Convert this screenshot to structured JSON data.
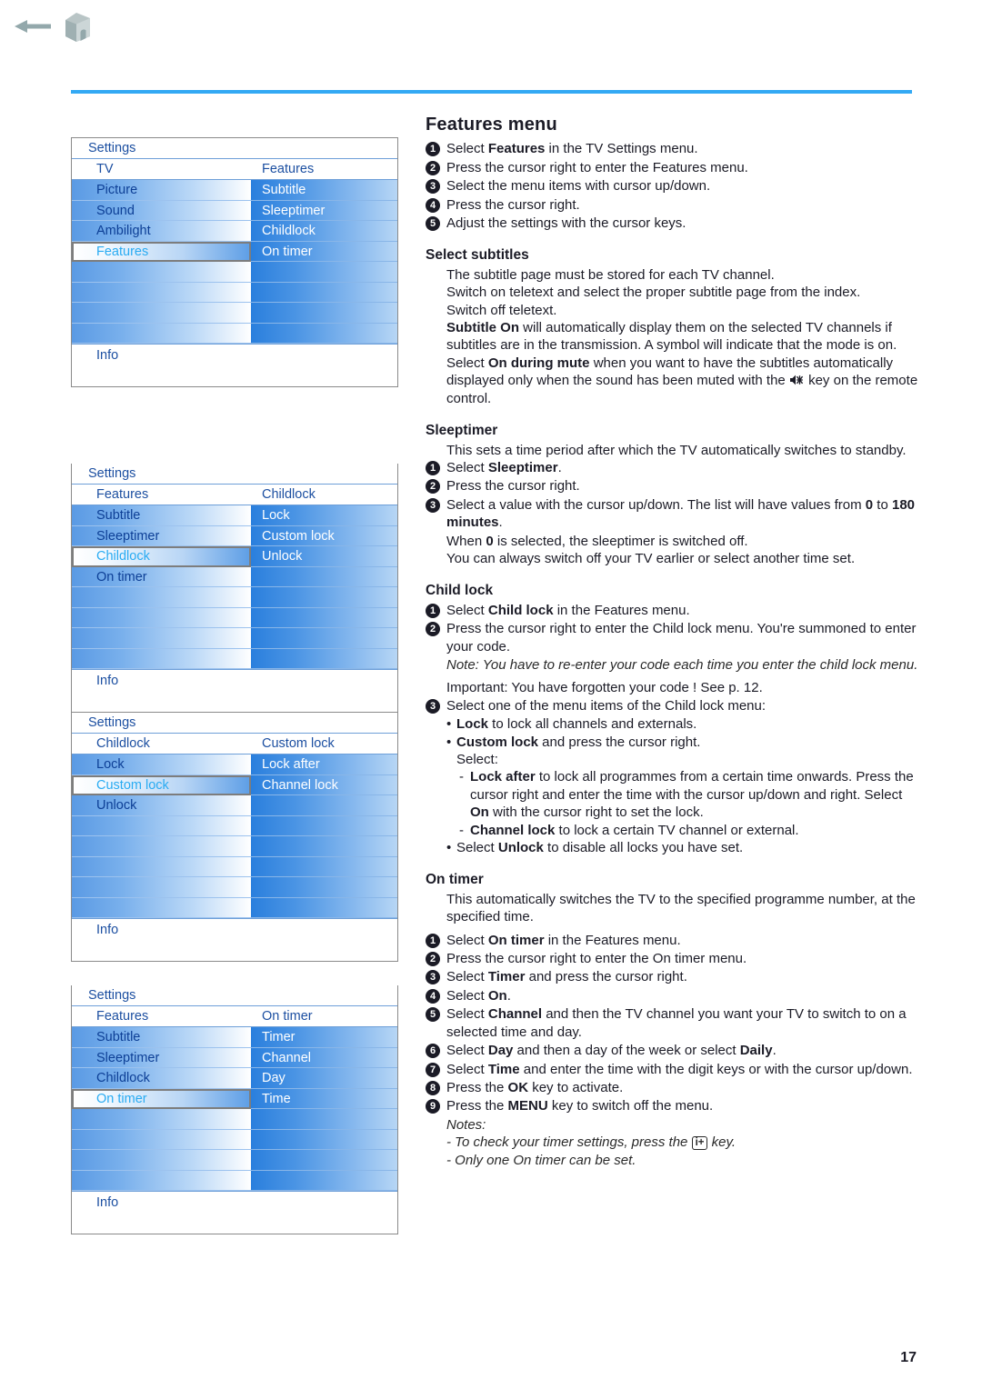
{
  "header": {
    "back_icon": "back-arrow-icon",
    "home_icon": "home-icon",
    "divider_color": "#33a9f4"
  },
  "page_number": "17",
  "menus": [
    {
      "title": "Settings",
      "head_left": "TV",
      "head_right": "Features",
      "left_items": [
        "Picture",
        "Sound",
        "Ambilight",
        "Features",
        "",
        "",
        "",
        ""
      ],
      "left_selected_index": 3,
      "right_items": [
        "Subtitle",
        "Sleeptimer",
        "Childlock",
        "On timer",
        "",
        "",
        "",
        ""
      ],
      "info": "Info"
    },
    {
      "title": "Settings",
      "head_left": "Features",
      "head_right": "Childlock",
      "left_items": [
        "Subtitle",
        "Sleeptimer",
        "Childlock",
        "On timer",
        "",
        "",
        "",
        ""
      ],
      "left_selected_index": 2,
      "right_items": [
        "Lock",
        "Custom lock",
        "Unlock",
        "",
        "",
        "",
        "",
        ""
      ],
      "info": "Info"
    },
    {
      "title": "Settings",
      "head_left": "Childlock",
      "head_right": "Custom lock",
      "left_items": [
        "Lock",
        "Custom lock",
        "Unlock",
        "",
        "",
        "",
        "",
        ""
      ],
      "left_selected_index": 1,
      "right_items": [
        "Lock after",
        "Channel lock",
        "",
        "",
        "",
        "",
        "",
        ""
      ],
      "info": "Info"
    },
    {
      "title": "Settings",
      "head_left": "Features",
      "head_right": "On timer",
      "left_items": [
        "Subtitle",
        "Sleeptimer",
        "Childlock",
        "On timer",
        "",
        "",
        "",
        ""
      ],
      "left_selected_index": 3,
      "right_items": [
        "Timer",
        "Channel",
        "Day",
        "Time",
        "",
        "",
        "",
        ""
      ],
      "info": "Info"
    }
  ],
  "content": {
    "title": "Features menu",
    "intro_steps": [
      "Select Features in the TV Settings menu.",
      "Press the cursor right to enter the Features menu.",
      "Select the menu items with cursor up/down.",
      "Press the cursor right.",
      "Adjust the settings with the cursor keys."
    ],
    "select_subtitles": {
      "heading": "Select subtitles",
      "lines": [
        "The subtitle page must be stored for each TV channel.",
        "Switch on teletext and select the proper subtitle page from the index.",
        "Switch off teletext.",
        "Subtitle On will automatically display them on the selected TV channels if subtitles are in the transmission. A symbol will indicate that the mode is on.",
        "Select On during mute when you want to have the subtitles automatically displayed only when the sound has been muted with the  key on the remote control."
      ]
    },
    "sleeptimer": {
      "heading": "Sleeptimer",
      "intro": "This sets a time period after which the TV automatically switches to standby.",
      "steps": [
        "Select Sleeptimer.",
        "Press the cursor right.",
        "Select a value with the cursor up/down. The list will have values from 0 to 180 minutes."
      ],
      "extra": [
        "When 0 is selected, the sleeptimer is switched off.",
        "You can always switch off your TV earlier or select another time set."
      ]
    },
    "child_lock": {
      "heading": "Child lock",
      "step1": "Select Child lock in the Features menu.",
      "step2": "Press the cursor right to enter the Child lock menu. You're summoned to enter your code.",
      "note": "Note: You have to re-enter your code each time you enter the child lock menu.",
      "important": "Important: You have forgotten your code ! See p. 12.",
      "step3": "Select one of the menu items of the Child lock menu:",
      "bullet_lock": "Lock to lock all channels and externals.",
      "bullet_custom": "Custom lock and press the cursor right.",
      "select_label": "Select:",
      "dash_lock_after": "Lock after to lock all programmes from a certain time onwards. Press the cursor right and enter the time with the cursor up/down and right. Select On with the cursor right to set the lock.",
      "dash_channel_lock": "Channel lock to lock a certain TV channel or external.",
      "bullet_unlock": "Select Unlock to disable all locks you have set."
    },
    "on_timer": {
      "heading": "On timer",
      "intro": "This automatically switches the TV to the specified programme number, at the specified time.",
      "steps": [
        "Select On timer in the Features menu.",
        "Press the cursor right to enter the On timer menu.",
        "Select Timer and press the cursor right.",
        "Select On.",
        "Select Channel and then the TV channel you want your TV to switch to on a selected time and day.",
        "Select Day and then a day of the week or select Daily.",
        "Select Time and enter the time with the digit keys or with the cursor up/down.",
        "Press the OK key to activate.",
        "Press the MENU key to switch off the menu."
      ],
      "notes_label": "Notes:",
      "note1_pre": "- To check your timer settings, press the",
      "note1_key": "i+",
      "note1_post": "key.",
      "note2": "- Only one On timer can be set."
    }
  }
}
